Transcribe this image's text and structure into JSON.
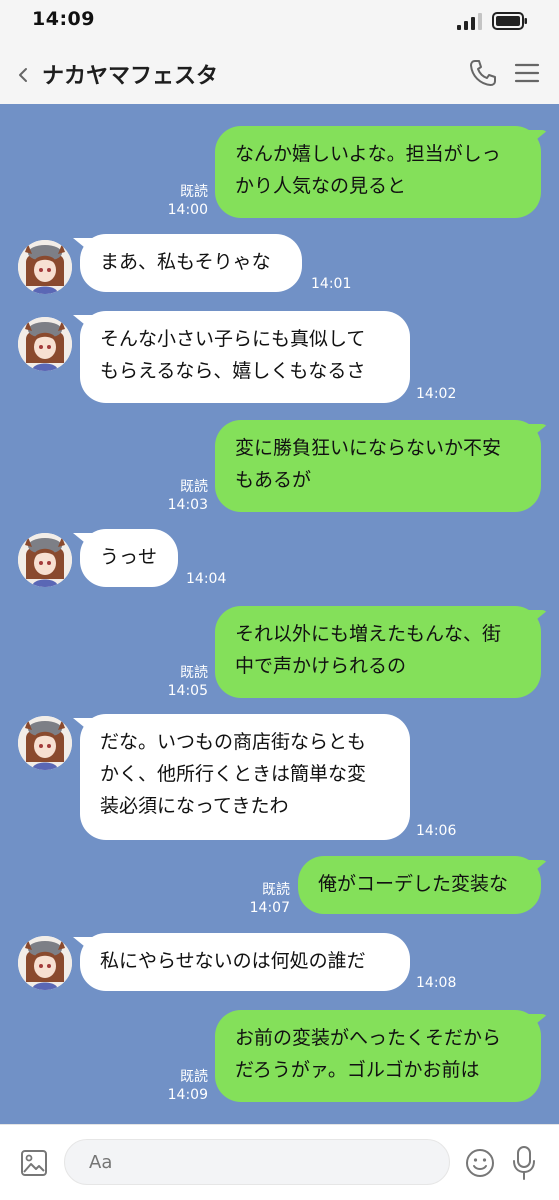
{
  "status": {
    "time": "14:09"
  },
  "header": {
    "title": "ナカヤマフェスタ"
  },
  "messages": [
    {
      "side": "right",
      "text": "なんか嬉しいよな。担当がしっ\nかり人気なの見ると",
      "read": "既読",
      "time": "14:00"
    },
    {
      "side": "left",
      "text": "まあ、私もそりゃな",
      "time": "14:01"
    },
    {
      "side": "left",
      "text": "そんな小さい子らにも真似して\nもらえるなら、嬉しくもなるさ",
      "time": "14:02"
    },
    {
      "side": "right",
      "text": "変に勝負狂いにならないか不安\nもあるが",
      "read": "既読",
      "time": "14:03"
    },
    {
      "side": "left",
      "text": "うっせ",
      "time": "14:04"
    },
    {
      "side": "right",
      "text": "それ以外にも増えたもんな、街\n中で声かけられるの",
      "read": "既読",
      "time": "14:05"
    },
    {
      "side": "left",
      "text": "だな。いつもの商店街ならとも\nかく、他所行くときは簡単な変\n装必須になってきたわ",
      "time": "14:06"
    },
    {
      "side": "right",
      "text": "俺がコーデした変装な",
      "read": "既読",
      "time": "14:07"
    },
    {
      "side": "left",
      "text": "私にやらせないのは何処の誰だ",
      "time": "14:08"
    },
    {
      "side": "right",
      "text": "お前の変装がへったくそだから\nだろうがァ。ゴルゴかお前は",
      "read": "既読",
      "time": "14:09"
    }
  ],
  "input": {
    "placeholder": "Aa"
  },
  "icons": {
    "back": "chevron-left-icon",
    "phone": "phone-icon",
    "menu": "hamburger-menu-icon",
    "image": "image-icon",
    "emoji": "smiley-icon",
    "mic": "microphone-icon"
  },
  "colors": {
    "chat_bg": "#7191c6",
    "sent_bubble": "#84e05a",
    "received_bubble": "#ffffff"
  }
}
